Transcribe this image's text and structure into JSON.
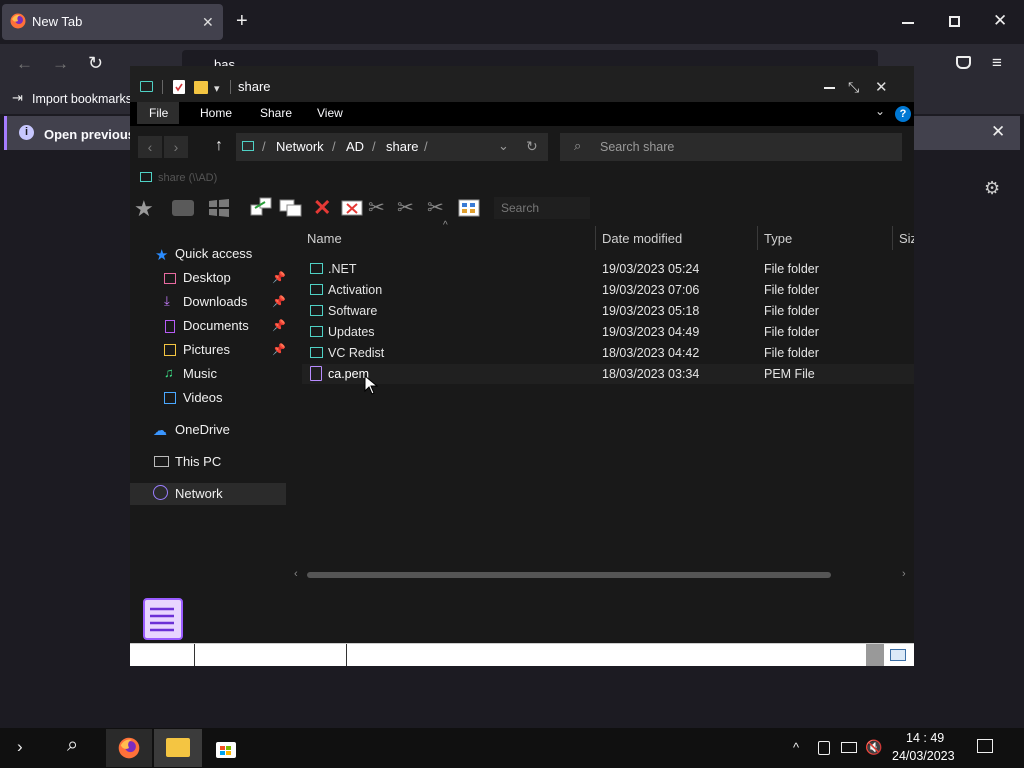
{
  "browser": {
    "tab_title": "New Tab",
    "url_text": "bas",
    "import_bookmarks": "Import bookmarks",
    "notice_text": "Open previous"
  },
  "explorer": {
    "title": "share",
    "ribbon_tabs": [
      "File",
      "Home",
      "Share",
      "View"
    ],
    "breadcrumb": [
      "Network",
      "AD",
      "share"
    ],
    "search_placeholder": "Search share",
    "tree_label": "share (\\\\AD)",
    "toolbar_search": "Search",
    "columns": {
      "name": "Name",
      "date": "Date modified",
      "type": "Type",
      "size": "Siz"
    },
    "nav": {
      "quick_access": "Quick access",
      "items": [
        {
          "label": "Desktop",
          "pinned": true,
          "icon": "desktop-icon"
        },
        {
          "label": "Downloads",
          "pinned": true,
          "icon": "download-icon"
        },
        {
          "label": "Documents",
          "pinned": true,
          "icon": "documents-icon"
        },
        {
          "label": "Pictures",
          "pinned": true,
          "icon": "pictures-icon"
        },
        {
          "label": "Music",
          "pinned": false,
          "icon": "music-icon"
        },
        {
          "label": "Videos",
          "pinned": false,
          "icon": "videos-icon"
        }
      ],
      "onedrive": "OneDrive",
      "this_pc": "This PC",
      "network": "Network"
    },
    "files": [
      {
        "name": ".NET",
        "date": "19/03/2023 05:24",
        "type": "File folder",
        "icon": "folder-icon"
      },
      {
        "name": "Activation",
        "date": "19/03/2023 07:06",
        "type": "File folder",
        "icon": "folder-icon"
      },
      {
        "name": "Software",
        "date": "19/03/2023 05:18",
        "type": "File folder",
        "icon": "folder-icon"
      },
      {
        "name": "Updates",
        "date": "19/03/2023 04:49",
        "type": "File folder",
        "icon": "folder-icon"
      },
      {
        "name": "VC Redist",
        "date": "18/03/2023 04:42",
        "type": "File folder",
        "icon": "folder-icon"
      },
      {
        "name": "ca.pem",
        "date": "18/03/2023 03:34",
        "type": "PEM File",
        "icon": "document-icon"
      }
    ]
  },
  "taskbar": {
    "time": "14 : 49",
    "date": "24/03/2023"
  },
  "colors": {
    "folder": "#4fd1c5",
    "accent": "#0078d4",
    "notice_accent": "#a67cff"
  }
}
